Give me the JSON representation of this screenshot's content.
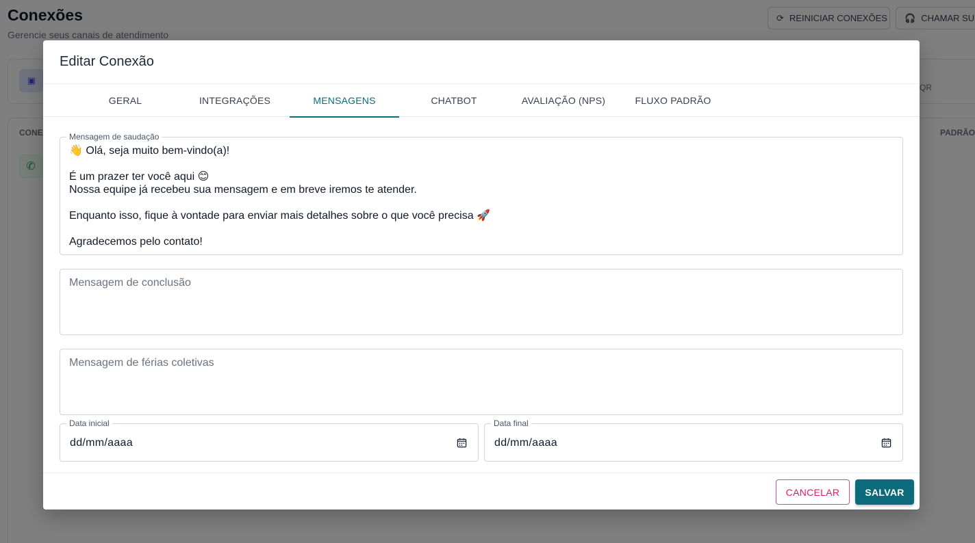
{
  "background": {
    "title": "Conexões",
    "subtitle": "Gerencie seus canais de atendimento",
    "restart_button": "REINICIAR CONEXÕES",
    "support_button": "CHAMAR SUP",
    "qr_text": "QR",
    "table_header_connection": "CONE",
    "table_header_default": "PADRÃO"
  },
  "modal": {
    "title": "Editar Conexão",
    "tabs": [
      {
        "label": "GERAL"
      },
      {
        "label": "INTEGRAÇÕES"
      },
      {
        "label": "MENSAGENS",
        "active": true
      },
      {
        "label": "CHATBOT"
      },
      {
        "label": "AVALIAÇÃO (NPS)"
      },
      {
        "label": "FLUXO PADRÃO"
      }
    ],
    "greeting": {
      "label": "Mensagem de saudação",
      "value": "👋 Olá, seja muito bem-vindo(a)!\n\nÉ um prazer ter você aqui 😊\nNossa equipe já recebeu sua mensagem e em breve iremos te atender.\n\nEnquanto isso, fique à vontade para enviar mais detalhes sobre o que você precisa 🚀\n\nAgradecemos pelo contato!"
    },
    "conclusion": {
      "placeholder": "Mensagem de conclusão"
    },
    "vacation": {
      "placeholder": "Mensagem de férias coletivas"
    },
    "start_date": {
      "label": "Data inicial",
      "value": "dd/mm/aaaa"
    },
    "end_date": {
      "label": "Data final",
      "value": "dd/mm/aaaa"
    },
    "cancel_label": "CANCELAR",
    "save_label": "SALVAR"
  },
  "colors": {
    "accent": "#0b6b7a",
    "cancel": "#e11d67",
    "overlay": "rgba(0,0,0,0.5)"
  }
}
